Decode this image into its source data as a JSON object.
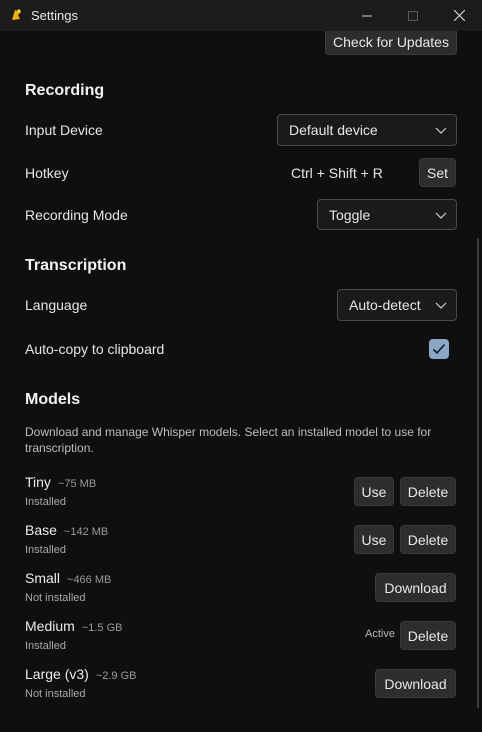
{
  "window": {
    "title": "Settings"
  },
  "top": {
    "check_updates_label": "Check for Updates"
  },
  "recording": {
    "title": "Recording",
    "input_device_label": "Input Device",
    "input_device_value": "Default device",
    "hotkey_label": "Hotkey",
    "hotkey_value": "Ctrl + Shift + R",
    "hotkey_set_label": "Set",
    "mode_label": "Recording Mode",
    "mode_value": "Toggle"
  },
  "transcription": {
    "title": "Transcription",
    "language_label": "Language",
    "language_value": "Auto-detect",
    "autocopy_label": "Auto-copy to clipboard",
    "autocopy_checked": true
  },
  "models": {
    "title": "Models",
    "description_line1": "Download and manage Whisper models. Select an installed model to use for",
    "description_line2": "transcription.",
    "items": [
      {
        "name": "Tiny",
        "size": "~75 MB",
        "status": "Installed",
        "use_label": "Use",
        "delete_label": "Delete"
      },
      {
        "name": "Base",
        "size": "~142 MB",
        "status": "Installed",
        "use_label": "Use",
        "delete_label": "Delete"
      },
      {
        "name": "Small",
        "size": "~466 MB",
        "status": "Not installed",
        "download_label": "Download"
      },
      {
        "name": "Medium",
        "size": "~1.5 GB",
        "status": "Installed",
        "active_label": "Active",
        "delete_label": "Delete"
      },
      {
        "name": "Large (v3)",
        "size": "~2.9 GB",
        "status": "Not installed",
        "download_label": "Download"
      }
    ]
  },
  "colors": {
    "background": "#0f0f0f",
    "titlebar": "#1c1c1c",
    "button": "#2d2d2d",
    "checkbox_accent": "#8aa8c6"
  }
}
